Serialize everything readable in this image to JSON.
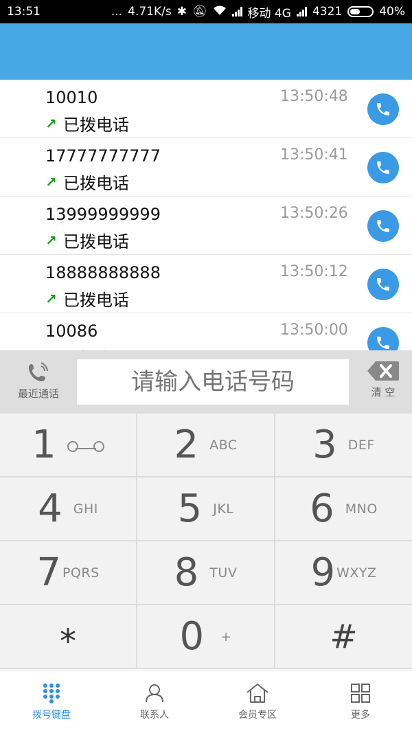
{
  "status_bar": {
    "time": "13:51",
    "dots": "...",
    "speed": "4.71K/s",
    "carrier": "移动 4G",
    "extra": "4321",
    "battery": "40%"
  },
  "call_log": [
    {
      "number": "10010",
      "type": "已拨电话",
      "time": "13:50:48"
    },
    {
      "number": "17777777777",
      "type": "已拨电话",
      "time": "13:50:41"
    },
    {
      "number": "13999999999",
      "type": "已拨电话",
      "time": "13:50:26"
    },
    {
      "number": "18888888888",
      "type": "已拨电话",
      "time": "13:50:12"
    },
    {
      "number": "10086",
      "type": "已拨电话",
      "time": "13:50:00"
    }
  ],
  "input_bar": {
    "recent_label": "最近通话",
    "placeholder": "请输入电话号码",
    "clear_label": "清 空"
  },
  "keypad": [
    {
      "digit": "1",
      "letters": ""
    },
    {
      "digit": "2",
      "letters": "ABC"
    },
    {
      "digit": "3",
      "letters": "DEF"
    },
    {
      "digit": "4",
      "letters": "GHI"
    },
    {
      "digit": "5",
      "letters": "JKL"
    },
    {
      "digit": "6",
      "letters": "MNO"
    },
    {
      "digit": "7",
      "letters": "PQRS"
    },
    {
      "digit": "8",
      "letters": "TUV"
    },
    {
      "digit": "9",
      "letters": "WXYZ"
    },
    {
      "digit": "*",
      "letters": ""
    },
    {
      "digit": "0",
      "letters": "+"
    },
    {
      "digit": "#",
      "letters": ""
    }
  ],
  "bottom_nav": [
    {
      "label": "拨号键盘",
      "icon": "dialpad-icon",
      "active": true
    },
    {
      "label": "联系人",
      "icon": "person-icon",
      "active": false
    },
    {
      "label": "会员专区",
      "icon": "home-icon",
      "active": false
    },
    {
      "label": "更多",
      "icon": "grid-icon",
      "active": false
    }
  ],
  "colors": {
    "title_bar": "#48a8e6",
    "call_button": "#3b9ae6",
    "outgoing_arrow": "#1a9a1a",
    "active_nav": "#2f8fe0"
  }
}
